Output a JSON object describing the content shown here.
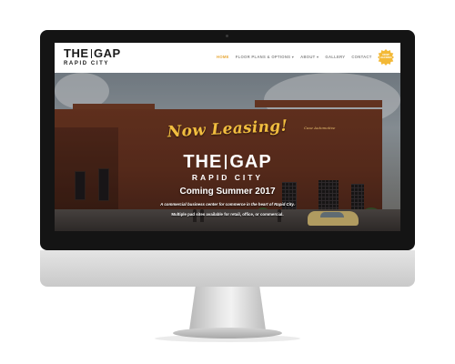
{
  "header": {
    "logo_main_left": "THE",
    "logo_main_right": "GAP",
    "logo_sub": "RAPID CITY",
    "badge_text": "NOW LEASING"
  },
  "nav": {
    "items": [
      {
        "label": "HOME",
        "active": true
      },
      {
        "label": "FLOOR PLANS & OPTIONS ▾",
        "active": false
      },
      {
        "label": "ABOUT ▾",
        "active": false
      },
      {
        "label": "GALLERY",
        "active": false
      },
      {
        "label": "CONTACT",
        "active": false
      }
    ]
  },
  "hero": {
    "script_heading": "Now Leasing!",
    "building_sign": "Case Automotive",
    "logo_main_left": "THE",
    "logo_main_right": "GAP",
    "logo_sub": "RAPID CITY",
    "coming_text": "Coming Summer 2017",
    "tagline": "A commercial business center for commerce in the heart of Rapid City.",
    "multiple_text": "Multiple pad sites available for retail, office, or commercial."
  },
  "colors": {
    "accent": "#e8a93a",
    "script_gold": "#f1bd3f",
    "badge": "#f3b937",
    "brick": "#6c3522"
  }
}
